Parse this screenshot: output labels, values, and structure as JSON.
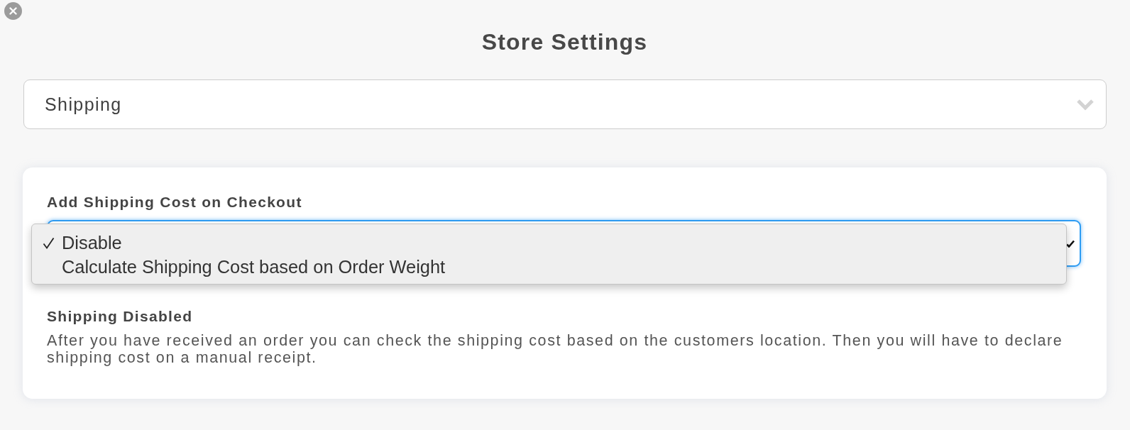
{
  "title": "Store Settings",
  "section_select": {
    "value": "Shipping"
  },
  "shipping_cost": {
    "label": "Add Shipping Cost on Checkout",
    "select": {
      "focused": true,
      "expanded": true,
      "options": [
        {
          "label": "Disable",
          "selected": true
        },
        {
          "label": "Calculate Shipping Cost based on Order Weight",
          "selected": false
        }
      ]
    }
  },
  "info": {
    "heading": "Shipping Disabled",
    "text": "After you have received an order you can check the shipping cost based on the customers location. Then you will have to declare shipping cost on a manual receipt."
  }
}
